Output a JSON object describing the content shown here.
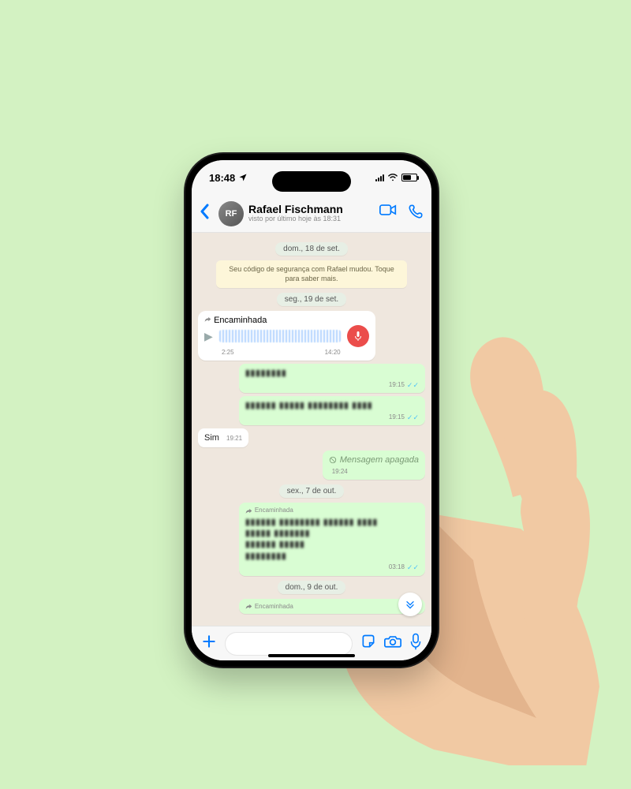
{
  "status_bar": {
    "time": "18:48"
  },
  "header": {
    "contact_name": "Rafael Fischmann",
    "last_seen": "visto por último hoje às 18:31",
    "avatar_initials": "RF"
  },
  "chat": {
    "date1": "dom., 18 de set.",
    "security_notice": "Seu código de segurança com Rafael mudou. Toque para saber mais.",
    "date2": "seg., 19 de set.",
    "voice": {
      "forward_label": "Encaminhada",
      "duration": "2:25",
      "time": "14:20"
    },
    "sent1": {
      "text": "▮▮▮▮▮▮▮▮",
      "time": "19:15"
    },
    "sent2": {
      "text": "▮▮▮▮▮▮ ▮▮▮▮▮ ▮▮▮▮▮▮▮▮ ▮▮▮▮",
      "time": "19:15"
    },
    "recv1": {
      "text": "Sim",
      "time": "19:21"
    },
    "deleted": {
      "label": "Mensagem apagada",
      "time": "19:24"
    },
    "date3": "sex., 7 de out.",
    "sent3": {
      "forward_label": "Encaminhada",
      "l1": "▮▮▮▮▮▮ ▮▮▮▮▮▮▮▮ ▮▮▮▮▮▮ ▮▮▮▮",
      "l2": "▮▮▮▮▮ ▮▮▮▮▮▮▮",
      "l3": "▮▮▮▮▮▮ ▮▮▮▮▮",
      "l4": "▮▮▮▮▮▮▮▮",
      "time": "03:18"
    },
    "date4": "dom., 9 de out.",
    "sent4": {
      "forward_label": "Encaminhada"
    }
  },
  "input": {
    "placeholder": ""
  }
}
